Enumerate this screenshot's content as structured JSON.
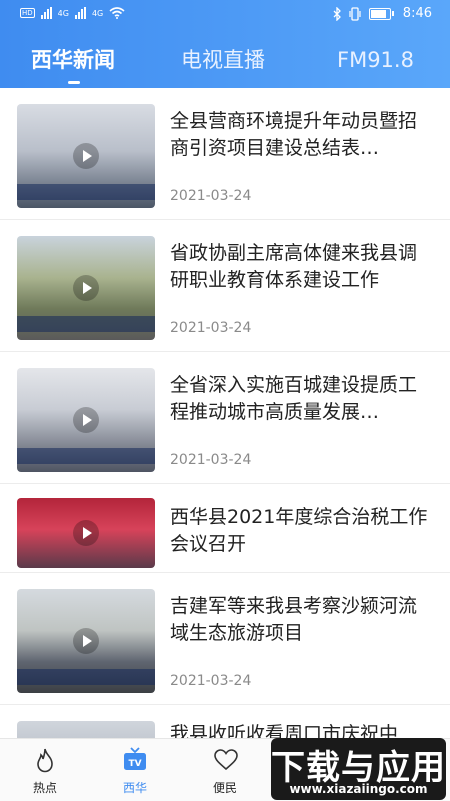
{
  "status_bar": {
    "sim1": "4G",
    "sim2": "4G",
    "time": "8:46"
  },
  "tabs": [
    {
      "label": "西华新闻",
      "active": true
    },
    {
      "label": "电视直播",
      "active": false
    },
    {
      "label": "FM91.8",
      "active": false
    }
  ],
  "news": [
    {
      "title": "全县营商环境提升年动员暨招商引资项目建设总结表…",
      "date": "2021-03-24",
      "has_date": true
    },
    {
      "title": "省政协副主席高体健来我县调研职业教育体系建设工作",
      "date": "2021-03-24",
      "has_date": true
    },
    {
      "title": "全省深入实施百城建设提质工程推动城市高质量发展…",
      "date": "2021-03-24",
      "has_date": true
    },
    {
      "title": "西华县2021年度综合治税工作会议召开",
      "date": "",
      "has_date": false
    },
    {
      "title": "吉建军等来我县考察沙颍河流域生态旅游项目",
      "date": "2021-03-24",
      "has_date": true
    },
    {
      "title": "我县收听收看周口市庆祝中",
      "date": "",
      "has_date": false
    }
  ],
  "bottom_nav": [
    {
      "label": "热点",
      "icon": "flame-icon",
      "active": false
    },
    {
      "label": "西华",
      "icon": "tv-icon",
      "active": true
    },
    {
      "label": "便民",
      "icon": "heart-icon",
      "active": false
    }
  ],
  "watermark": {
    "main": "下载与应用",
    "sub": "www.xiazaiingo.com"
  },
  "colors": {
    "accent": "#3f8cf0",
    "header_end": "#5aa7fa"
  }
}
